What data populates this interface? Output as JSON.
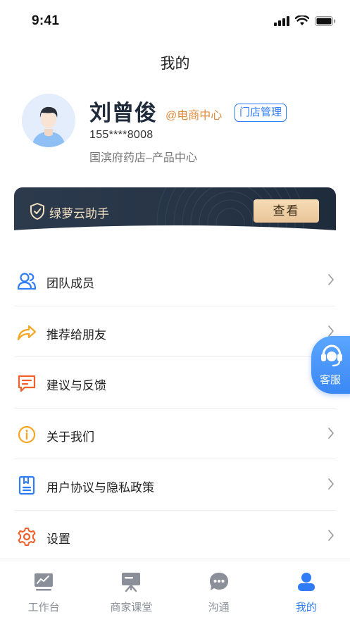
{
  "status_bar": {
    "time": "9:41"
  },
  "header": {
    "title": "我的"
  },
  "profile": {
    "name": "刘曾俊",
    "department": "@电商中心",
    "role_badge": "门店管理",
    "phone": "155****8008",
    "store": "国滨府药店–产品中心"
  },
  "assistant": {
    "title": "绿萝云助手",
    "button_label": "查看",
    "colors": {
      "card": "#263446",
      "title": "#f2e0c0",
      "button": "#efd0a6"
    }
  },
  "menu": {
    "items": [
      {
        "label": "团队成员",
        "icon": "team-icon",
        "color": "#2f7cf6"
      },
      {
        "label": "推荐给朋友",
        "icon": "share-icon",
        "color": "#f5a623"
      },
      {
        "label": "建议与反馈",
        "icon": "feedback-icon",
        "color": "#f0602a"
      },
      {
        "label": "关于我们",
        "icon": "info-icon",
        "color": "#f5a623"
      },
      {
        "label": "用户协议与隐私政策",
        "icon": "agreement-icon",
        "color": "#2f7cf6"
      },
      {
        "label": "设置",
        "icon": "settings-icon",
        "color": "#f0602a"
      }
    ]
  },
  "service": {
    "label": "客服"
  },
  "tab_bar": {
    "tabs": [
      {
        "label": "工作台",
        "icon": "dashboard-icon",
        "active": false
      },
      {
        "label": "商家课堂",
        "icon": "classroom-icon",
        "active": false
      },
      {
        "label": "沟通",
        "icon": "chat-icon",
        "active": false
      },
      {
        "label": "我的",
        "icon": "profile-icon",
        "active": true
      }
    ],
    "colors": {
      "active": "#2f7cf6",
      "inactive": "#8a8f99"
    }
  }
}
